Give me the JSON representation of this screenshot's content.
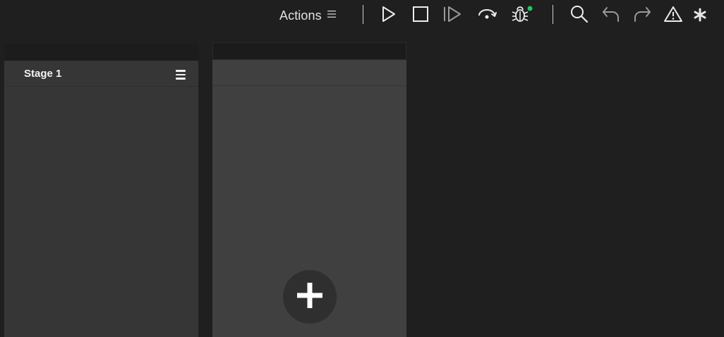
{
  "toolbar": {
    "actions_label": "Actions",
    "icons": [
      "menu-icon",
      "run-icon",
      "stop-icon",
      "step-icon",
      "step-over-icon",
      "debug-icon",
      "search-icon",
      "undo-icon",
      "redo-icon",
      "warning-icon",
      "asterisk-icon"
    ],
    "debug_status_color": "#22c55e"
  },
  "stages": [
    {
      "title": "Stage 1",
      "menu_icon": "menu-icon"
    }
  ],
  "new_stage": {
    "icon": "plus-icon"
  },
  "colors": {
    "background": "#1f1f1f",
    "stage": "#363636",
    "new_stage": "#404040",
    "text": "#e6e6e6"
  }
}
